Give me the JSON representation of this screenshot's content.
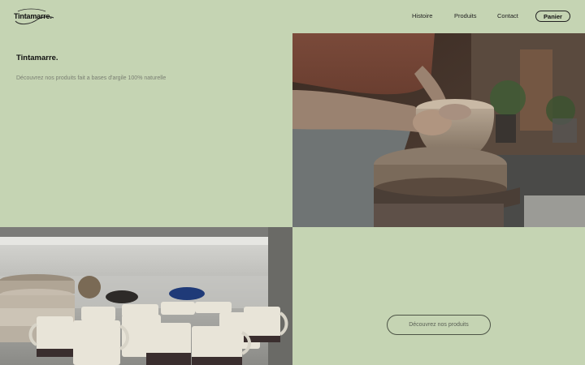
{
  "header": {
    "logo_text": "Tintamarre.",
    "nav": [
      "Histoire",
      "Produits",
      "Contact"
    ],
    "cart_label": "Panier"
  },
  "hero": {
    "title": "Tintamarre.",
    "subtitle": "Découvrez nos produits fait a bases d'argile 100% naturelle"
  },
  "cta": {
    "label": "Découvrez nos produits"
  },
  "colors": {
    "background": "#c5d4b3",
    "text": "#1d1d1d"
  }
}
